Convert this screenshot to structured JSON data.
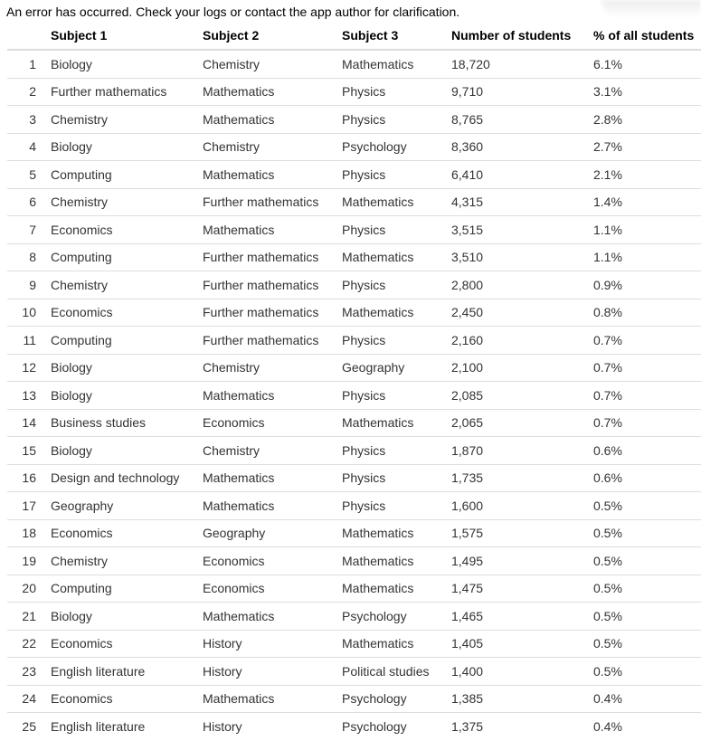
{
  "error_message": "An error has occurred. Check your logs or contact the app author for clarification.",
  "table": {
    "headers": [
      "",
      "Subject 1",
      "Subject 2",
      "Subject 3",
      "Number of students",
      "% of all students"
    ],
    "rows": [
      [
        "1",
        "Biology",
        "Chemistry",
        "Mathematics",
        "18,720",
        "6.1%"
      ],
      [
        "2",
        "Further mathematics",
        "Mathematics",
        "Physics",
        "9,710",
        "3.1%"
      ],
      [
        "3",
        "Chemistry",
        "Mathematics",
        "Physics",
        "8,765",
        "2.8%"
      ],
      [
        "4",
        "Biology",
        "Chemistry",
        "Psychology",
        "8,360",
        "2.7%"
      ],
      [
        "5",
        "Computing",
        "Mathematics",
        "Physics",
        "6,410",
        "2.1%"
      ],
      [
        "6",
        "Chemistry",
        "Further mathematics",
        "Mathematics",
        "4,315",
        "1.4%"
      ],
      [
        "7",
        "Economics",
        "Mathematics",
        "Physics",
        "3,515",
        "1.1%"
      ],
      [
        "8",
        "Computing",
        "Further mathematics",
        "Mathematics",
        "3,510",
        "1.1%"
      ],
      [
        "9",
        "Chemistry",
        "Further mathematics",
        "Physics",
        "2,800",
        "0.9%"
      ],
      [
        "10",
        "Economics",
        "Further mathematics",
        "Mathematics",
        "2,450",
        "0.8%"
      ],
      [
        "11",
        "Computing",
        "Further mathematics",
        "Physics",
        "2,160",
        "0.7%"
      ],
      [
        "12",
        "Biology",
        "Chemistry",
        "Geography",
        "2,100",
        "0.7%"
      ],
      [
        "13",
        "Biology",
        "Mathematics",
        "Physics",
        "2,085",
        "0.7%"
      ],
      [
        "14",
        "Business studies",
        "Economics",
        "Mathematics",
        "2,065",
        "0.7%"
      ],
      [
        "15",
        "Biology",
        "Chemistry",
        "Physics",
        "1,870",
        "0.6%"
      ],
      [
        "16",
        "Design and technology",
        "Mathematics",
        "Physics",
        "1,735",
        "0.6%"
      ],
      [
        "17",
        "Geography",
        "Mathematics",
        "Physics",
        "1,600",
        "0.5%"
      ],
      [
        "18",
        "Economics",
        "Geography",
        "Mathematics",
        "1,575",
        "0.5%"
      ],
      [
        "19",
        "Chemistry",
        "Economics",
        "Mathematics",
        "1,495",
        "0.5%"
      ],
      [
        "20",
        "Computing",
        "Economics",
        "Mathematics",
        "1,475",
        "0.5%"
      ],
      [
        "21",
        "Biology",
        "Mathematics",
        "Psychology",
        "1,465",
        "0.5%"
      ],
      [
        "22",
        "Economics",
        "History",
        "Mathematics",
        "1,405",
        "0.5%"
      ],
      [
        "23",
        "English literature",
        "History",
        "Political studies",
        "1,400",
        "0.5%"
      ],
      [
        "24",
        "Economics",
        "Mathematics",
        "Psychology",
        "1,385",
        "0.4%"
      ],
      [
        "25",
        "English literature",
        "History",
        "Psychology",
        "1,375",
        "0.4%"
      ]
    ]
  },
  "colors": {
    "border": "#dddddd",
    "text": "#333333",
    "header_text": "#000000"
  }
}
